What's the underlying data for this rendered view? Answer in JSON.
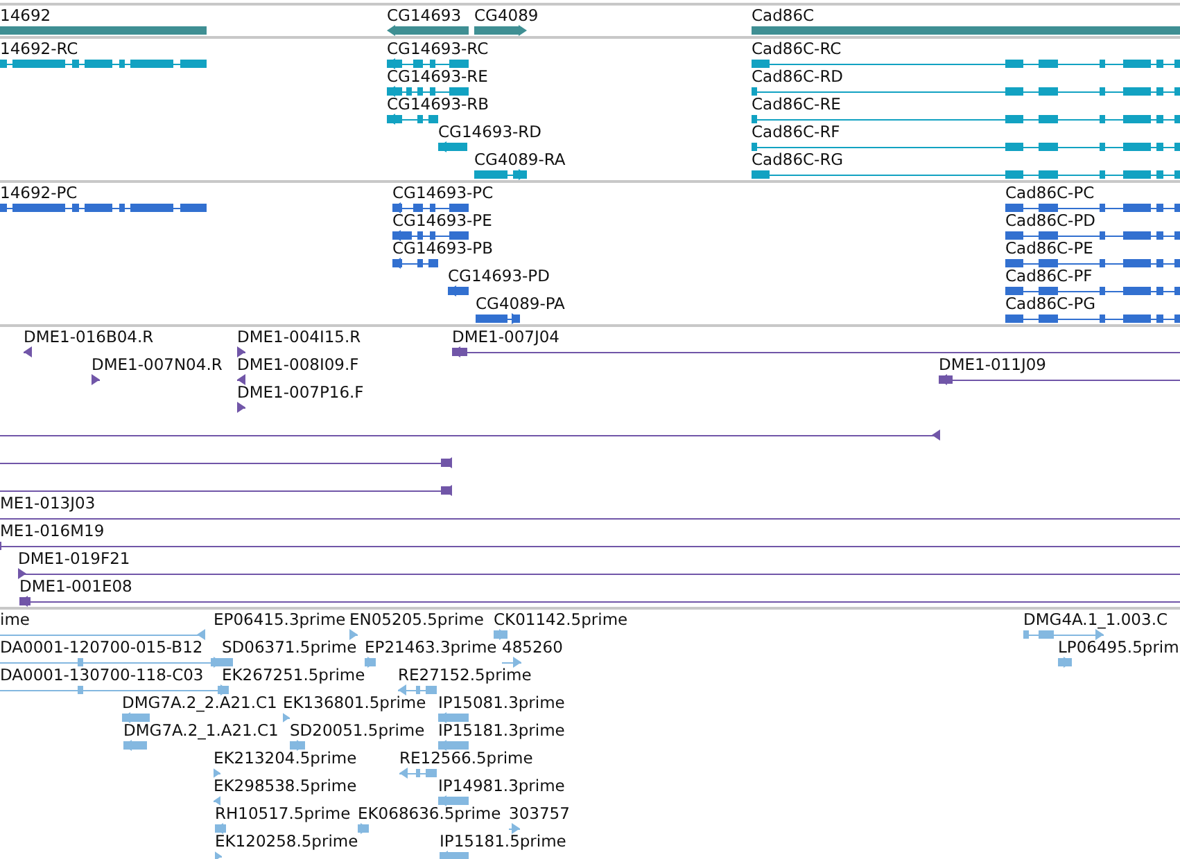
{
  "tracks": [
    {
      "kind": "gene",
      "features": [
        {
          "label": "14692"
        },
        {
          "label": "CG14693",
          "reverse": true
        },
        {
          "label": "CG4089",
          "reverse": false
        },
        {
          "label": "Cad86C"
        }
      ]
    },
    {
      "kind": "transcript",
      "features": [
        {
          "label": "14692-RC"
        },
        {
          "label": "CG14693-RC",
          "reverse": true
        },
        {
          "label": "CG14693-RE",
          "reverse": true
        },
        {
          "label": "CG14693-RB",
          "reverse": true
        },
        {
          "label": "CG14693-RD",
          "reverse": true
        },
        {
          "label": "CG4089-RA",
          "reverse": false
        },
        {
          "label": "Cad86C-RC"
        },
        {
          "label": "Cad86C-RD"
        },
        {
          "label": "Cad86C-RE"
        },
        {
          "label": "Cad86C-RF"
        },
        {
          "label": "Cad86C-RG"
        }
      ]
    },
    {
      "kind": "protein",
      "features": [
        {
          "label": "14692-PC"
        },
        {
          "label": "CG14693-PC",
          "reverse": true
        },
        {
          "label": "CG14693-PE",
          "reverse": true
        },
        {
          "label": "CG14693-PB",
          "reverse": true
        },
        {
          "label": "CG14693-PD",
          "reverse": true
        },
        {
          "label": "CG4089-PA",
          "reverse": false
        },
        {
          "label": "Cad86C-PC"
        },
        {
          "label": "Cad86C-PD"
        },
        {
          "label": "Cad86C-PE"
        },
        {
          "label": "Cad86C-PF"
        },
        {
          "label": "Cad86C-PG"
        }
      ]
    },
    {
      "kind": "clone",
      "features": [
        {
          "label": "DME1-016B04.R",
          "reverse": true
        },
        {
          "label": "DME1-004I15.R",
          "reverse": false
        },
        {
          "label": "DME1-007J04",
          "reverse": true
        },
        {
          "label": "DME1-007N04.R",
          "reverse": false
        },
        {
          "label": "DME1-008I09.F",
          "reverse": true
        },
        {
          "label": "DME1-011J09",
          "reverse": true
        },
        {
          "label": "DME1-007P16.F",
          "reverse": false
        },
        {
          "reverse": true
        },
        {
          "reverse": true
        },
        {
          "reverse": true
        },
        {
          "label": "ME1-013J03"
        },
        {
          "label": "ME1-016M19"
        },
        {
          "label": "DME1-019F21",
          "reverse": false
        },
        {
          "label": "DME1-001E08",
          "reverse": true
        }
      ]
    },
    {
      "kind": "est",
      "features": [
        {
          "label": "ime",
          "reverse": true
        },
        {
          "label": "EP06415.3prime"
        },
        {
          "label": "EN05205.5prime",
          "reverse": false
        },
        {
          "label": "CK01142.5prime",
          "reverse": false
        },
        {
          "label": "DMG4A.1_1.003.C",
          "reverse": false
        },
        {
          "label": "DA0001-120700-015-B12",
          "reverse": false
        },
        {
          "label": "SD06371.5prime"
        },
        {
          "label": "EP21463.3prime",
          "reverse": false
        },
        {
          "label": "485260",
          "reverse": false
        },
        {
          "label": "LP06495.5prim",
          "reverse": false
        },
        {
          "label": "DA0001-130700-118-C03",
          "reverse": false
        },
        {
          "label": "EK267251.5prime"
        },
        {
          "label": "RE27152.5prime",
          "reverse": true
        },
        {
          "label": "DMG7A.2_2.A21.C1",
          "reverse": true
        },
        {
          "label": "EK136801.5prime",
          "reverse": false
        },
        {
          "label": "IP15081.3prime",
          "reverse": true
        },
        {
          "label": "DMG7A.2_1.A21.C1",
          "reverse": true
        },
        {
          "label": "SD20051.5prime",
          "reverse": false
        },
        {
          "label": "IP15181.3prime",
          "reverse": true
        },
        {
          "label": "EK213204.5prime",
          "reverse": false
        },
        {
          "label": "RE12566.5prime",
          "reverse": true
        },
        {
          "label": "EK298538.5prime",
          "reverse": true
        },
        {
          "label": "IP14981.3prime",
          "reverse": true
        },
        {
          "label": "RH10517.5prime",
          "reverse": true
        },
        {
          "label": "EK068636.5prime",
          "reverse": false
        },
        {
          "label": "303757",
          "reverse": false
        },
        {
          "label": "EK120258.5prime",
          "reverse": false
        },
        {
          "label": "IP15181.5prime",
          "reverse": true
        }
      ]
    }
  ]
}
